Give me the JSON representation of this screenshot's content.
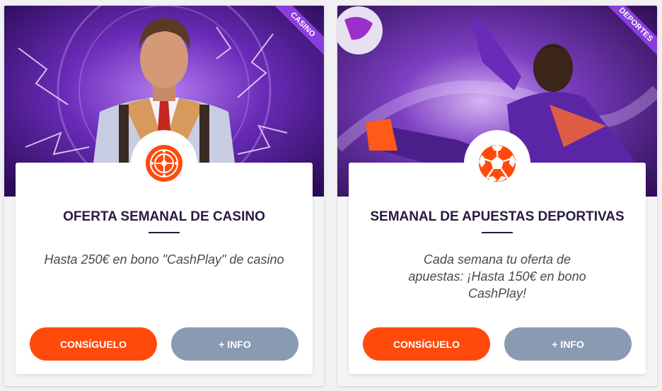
{
  "colors": {
    "accent_orange": "#ff4a0c",
    "info_gray": "#8a9ab3",
    "ribbon_purple": "#8a3ddc",
    "title_dark": "#2a1a3e"
  },
  "cards": [
    {
      "ribbon": "CASINO",
      "icon": "roulette-icon",
      "title": "OFERTA SEMANAL DE CASINO",
      "description": "Hasta 250€ en bono \"CashPlay\" de casino",
      "primary_button": "CONSÍGUELO",
      "secondary_button": "+ INFO"
    },
    {
      "ribbon": "DEPORTES",
      "icon": "soccer-ball-icon",
      "title": "SEMANAL DE APUESTAS DEPORTIVAS",
      "description": "Cada semana tu oferta de apuestas: ¡Hasta 150€ en bono CashPlay!",
      "primary_button": "CONSÍGUELO",
      "secondary_button": "+ INFO"
    }
  ]
}
